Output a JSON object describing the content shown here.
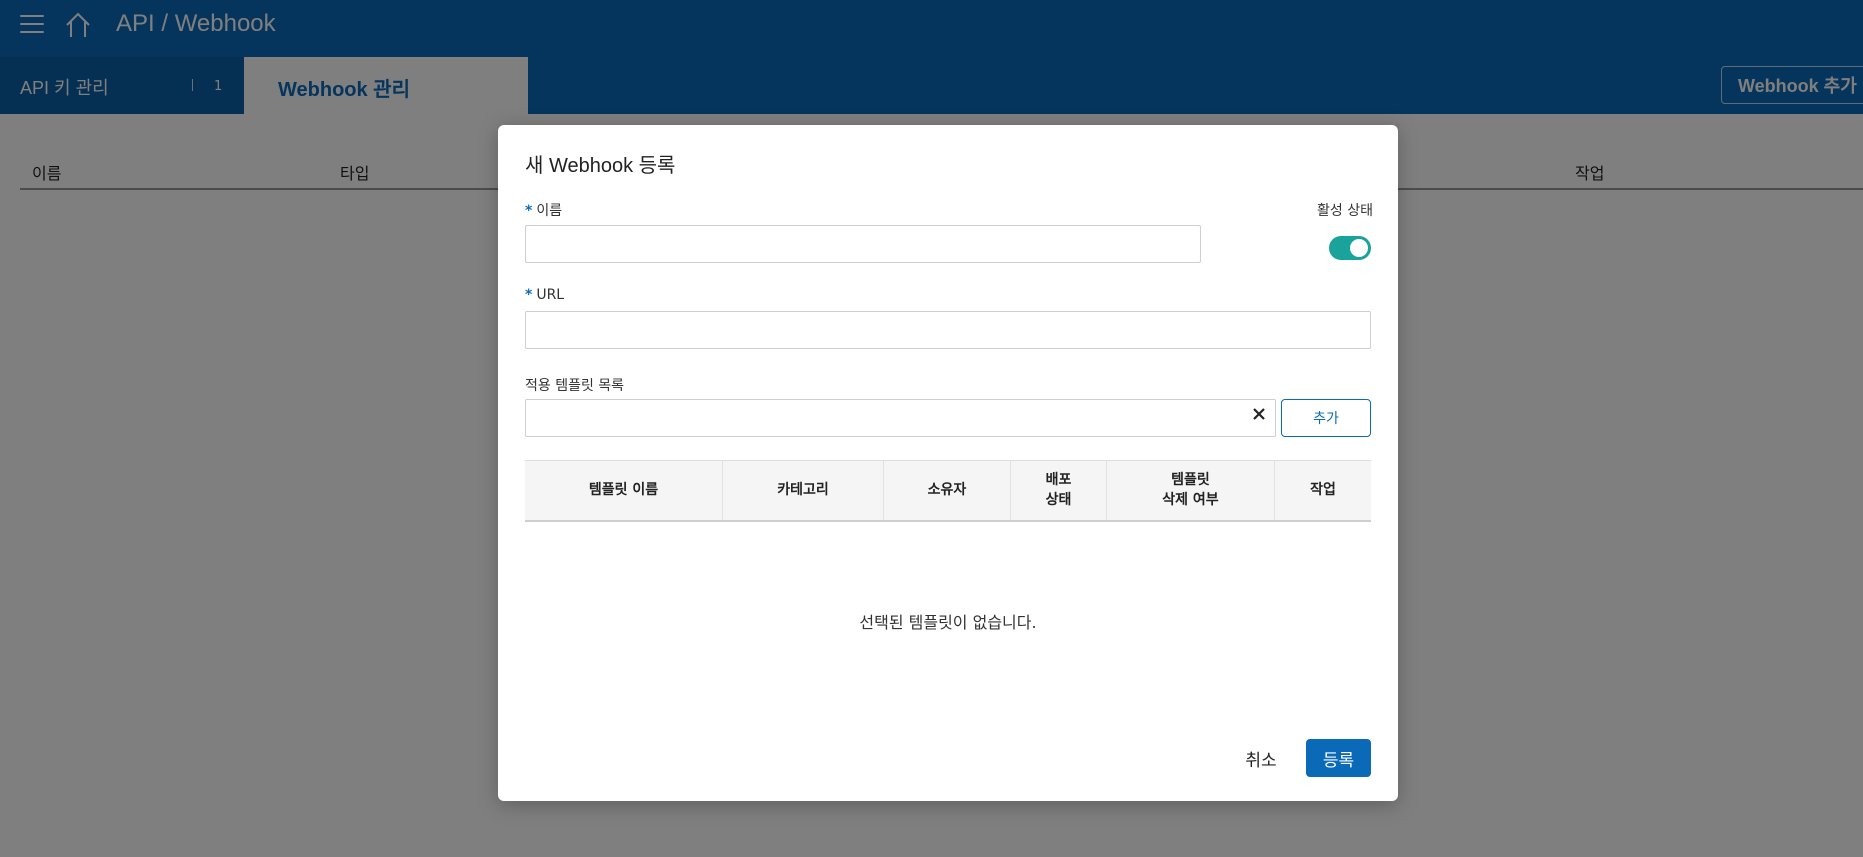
{
  "header": {
    "title": "API / Webhook"
  },
  "tabs": {
    "api_keys": {
      "label": "API 키 관리",
      "count": "1"
    },
    "webhook": {
      "label": "Webhook 관리"
    }
  },
  "toolbar": {
    "add_webhook_label": "Webhook 추가"
  },
  "background_table": {
    "columns": [
      "이름",
      "타입",
      "작업"
    ]
  },
  "modal": {
    "title": "새 Webhook 등록",
    "name_label": "이름",
    "name_value": "",
    "active_label": "활성 상태",
    "active": true,
    "url_label": "URL",
    "url_value": "",
    "template_list_label": "적용 템플릿 목록",
    "template_search_value": "",
    "add_label": "추가",
    "table_columns": [
      "템플릿 이름",
      "카테고리",
      "소유자",
      "배포\n상태",
      "템플릿\n삭제 여부",
      "작업"
    ],
    "empty_message": "선택된 템플릿이 없습니다.",
    "cancel_label": "취소",
    "submit_label": "등록"
  },
  "colors": {
    "brand": "#0b6ab8",
    "toggle_on": "#1aa39a"
  },
  "icons": [
    "menu-icon",
    "home-icon",
    "close-icon"
  ]
}
